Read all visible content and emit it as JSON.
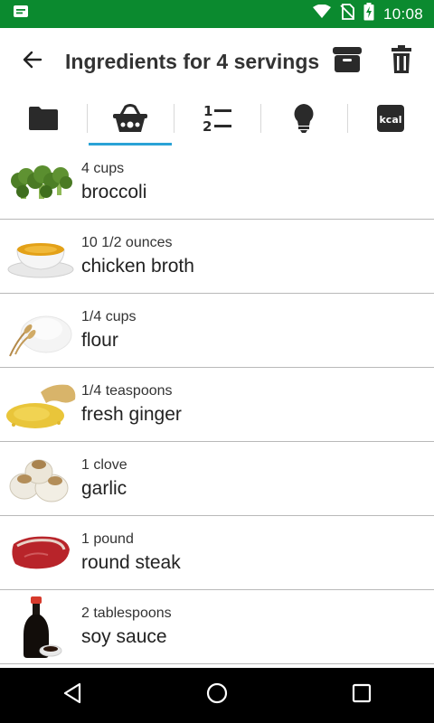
{
  "status_bar": {
    "time": "10:08",
    "icons": [
      "notification-message-icon",
      "wifi-icon",
      "no-sim-icon",
      "battery-charging-icon"
    ]
  },
  "app_bar": {
    "back_icon": "arrow-left-icon",
    "title": "Ingredients for 4 servings",
    "actions": [
      "archive-box-icon",
      "trash-icon"
    ]
  },
  "tabs": [
    {
      "name": "folder",
      "icon": "folder-icon",
      "active": false
    },
    {
      "name": "ingredients",
      "icon": "basket-icon",
      "active": true
    },
    {
      "name": "steps",
      "icon": "numbered-list-icon",
      "active": false
    },
    {
      "name": "tips",
      "icon": "lightbulb-icon",
      "active": false
    },
    {
      "name": "nutrition",
      "icon": "kcal-icon",
      "label": "kcal",
      "active": false
    }
  ],
  "ingredients": [
    {
      "quantity": "4 cups",
      "name": "broccoli",
      "image": "broccoli-image"
    },
    {
      "quantity": "10 1/2 ounces",
      "name": "chicken broth",
      "image": "chicken-broth-image"
    },
    {
      "quantity": "1/4 cups",
      "name": "flour",
      "image": "flour-image"
    },
    {
      "quantity": "1/4 teaspoons",
      "name": "fresh ginger",
      "image": "ginger-image"
    },
    {
      "quantity": "1 clove",
      "name": "garlic",
      "image": "garlic-image"
    },
    {
      "quantity": "1 pound",
      "name": "round steak",
      "image": "steak-image"
    },
    {
      "quantity": "2 tablespoons",
      "name": "soy sauce",
      "image": "soy-sauce-image"
    }
  ],
  "nav_bar": [
    "back-triangle-icon",
    "home-circle-icon",
    "recents-square-icon"
  ],
  "colors": {
    "status_bar": "#0b8a2f",
    "active_tab_indicator": "#2ba3d6",
    "icon_dark": "#2a2a2a"
  }
}
